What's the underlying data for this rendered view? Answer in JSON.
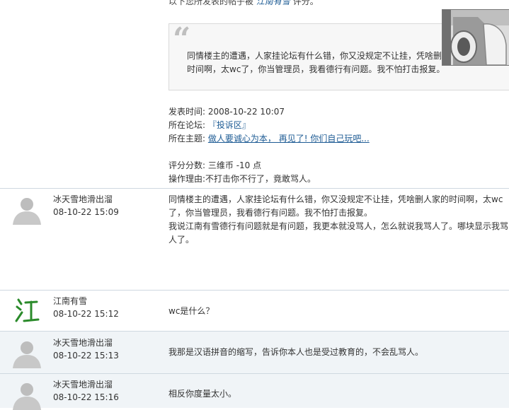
{
  "rating_notice": {
    "intro_prefix": "以下您所发表的帖子被",
    "rater": "江南有雪",
    "intro_suffix": "评分。",
    "quote": "同情楼主的遭遇，人家挂论坛有什么错，你又没规定不让挂，凭啥删人家的时间啊，太wc了，你当管理员，我看德行有问题。我不怕打击报复。",
    "posted_time_label": "发表时间:",
    "posted_time": "2008-10-22 10:07",
    "forum_label": "所在论坛:",
    "forum": "『投诉区』",
    "topic_label": "所在主题:",
    "topic": "做人要诚心为本， 再见了! 你们自己玩吧...",
    "score_label": "评分分数:",
    "score": "三维币 -10 点",
    "reason_label": "操作理由:",
    "reason": "不打击你不行了，竟敢骂人。"
  },
  "replies": [
    {
      "author": "冰天雪地滑出溜",
      "time": "08-10-22 15:09",
      "avatar": "default-avatar",
      "content": "同情楼主的遭遇，人家挂论坛有什么错，你又没规定不让挂，凭啥删人家的时间啊，太wc了，你当管理员，我看德行有问题。我不怕打击报复。\n我说江南有雪德行有问题就是有问题，我更本就没骂人，怎么就说我骂人了。哪块显示我骂人了。"
    },
    {
      "author": "江南有雪",
      "time": "08-10-22 15:12",
      "avatar": "jiang-calligraphy-avatar",
      "content": "wc是什么？"
    },
    {
      "author": "冰天雪地滑出溜",
      "time": "08-10-22 15:13",
      "avatar": "default-avatar",
      "content": "我那是汉语拼音的缩写，告诉你本人也是受过教育的，不会乱骂人。"
    },
    {
      "author": "冰天雪地滑出溜",
      "time": "08-10-22 15:16",
      "avatar": "default-avatar",
      "content": "相反你度量太小。"
    }
  ],
  "colors": {
    "link": "#1d5b94",
    "row_alt_bg": "#f0f4f7",
    "row_border": "#cfd8e0",
    "avatar_green": "#2a8a2a"
  }
}
